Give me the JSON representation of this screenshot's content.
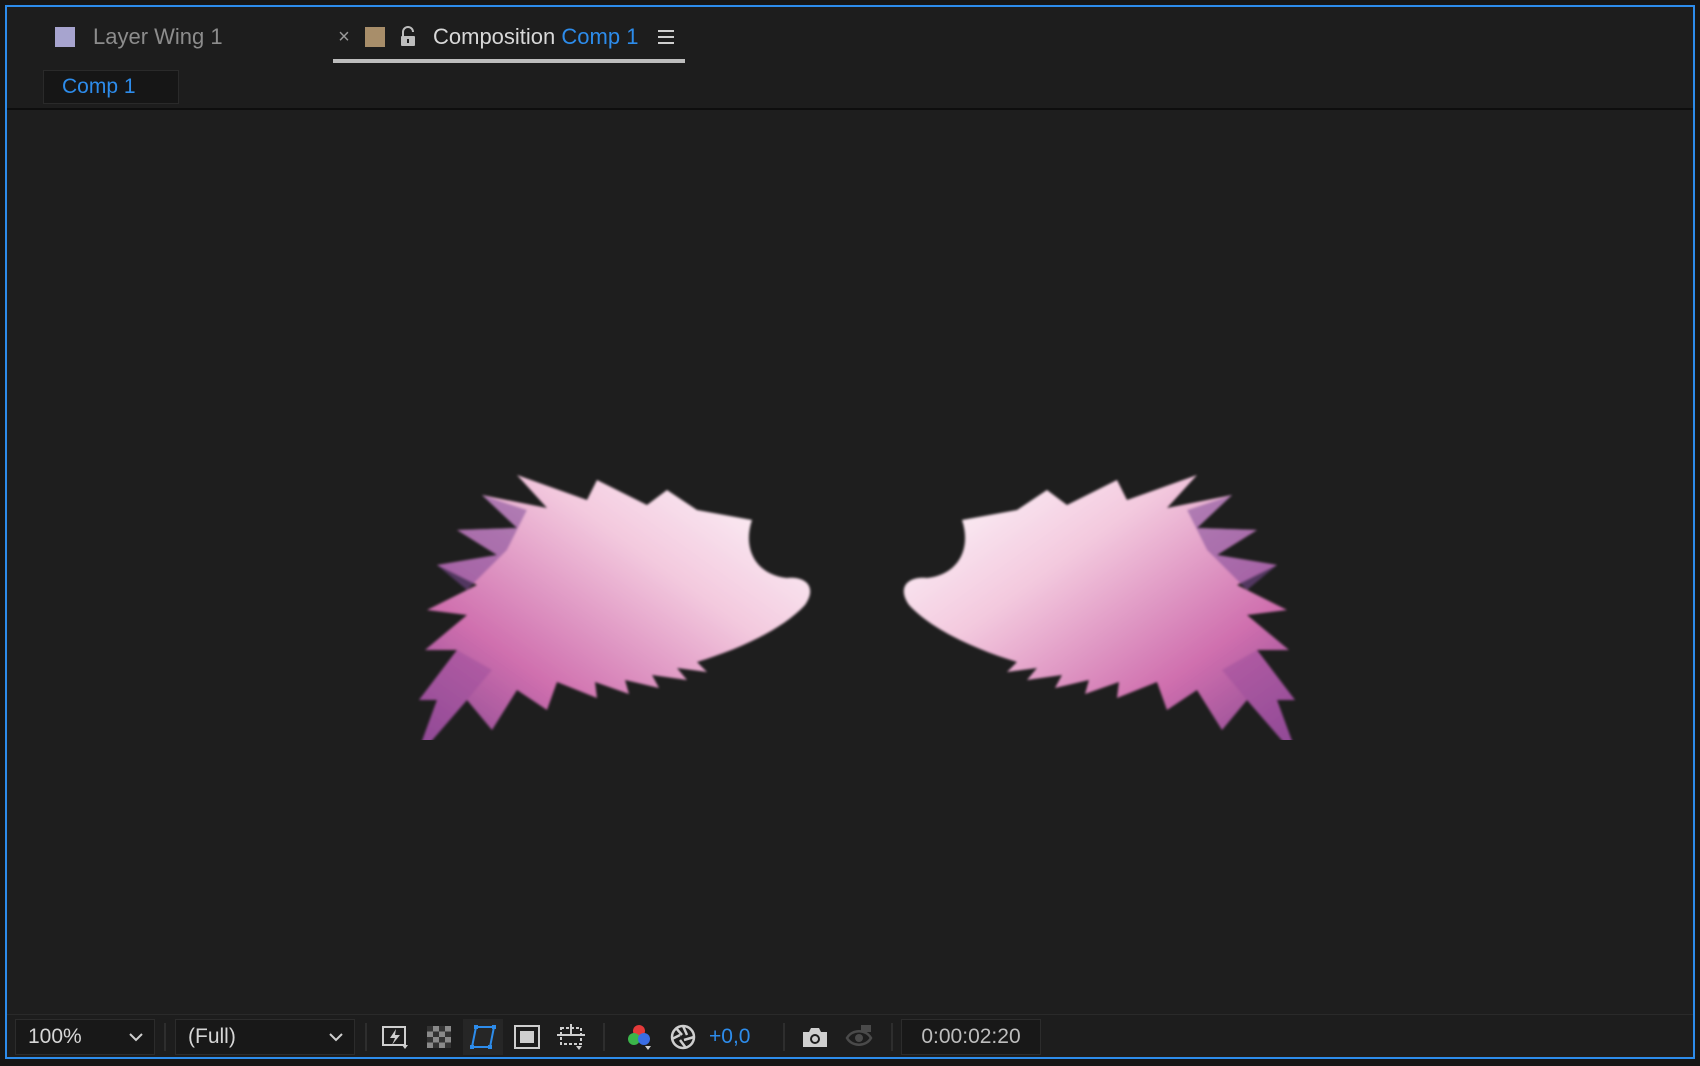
{
  "tabs": {
    "layer": {
      "label": "Layer Wing 1",
      "swatch_color": "#a7a4cf"
    },
    "composition": {
      "prefix": "Composition",
      "name": "Comp 1",
      "swatch_color": "#a88e6a"
    }
  },
  "breadcrumb": {
    "label": "Comp 1"
  },
  "toolbar": {
    "zoom": "100%",
    "resolution": "(Full)",
    "exposure": "+0,0",
    "timecode": "0:00:02:20"
  },
  "icons": [
    "close-icon",
    "lock-icon",
    "panel-menu-icon",
    "fast-previews-icon",
    "transparency-grid-icon",
    "mask-path-visibility-icon",
    "region-of-interest-icon",
    "toggle-guides-icon",
    "channel-icon",
    "reset-exposure-icon",
    "snapshot-icon",
    "show-snapshot-icon"
  ],
  "colors": {
    "accent": "#2d8ceb",
    "panel_bg": "#1d1d1d"
  }
}
